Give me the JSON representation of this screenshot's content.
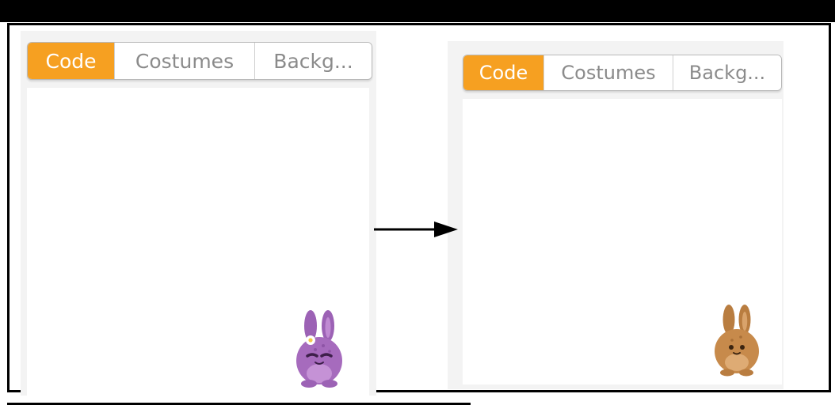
{
  "before": {
    "tabs": [
      {
        "label": "Code",
        "active": true
      },
      {
        "label": "Costumes",
        "active": false
      },
      {
        "label": "Backg...",
        "active": false
      }
    ],
    "sprite": {
      "icon": "purple-bunny-icon",
      "color": "#a66bbd"
    }
  },
  "after": {
    "tabs": [
      {
        "label": "Code",
        "active": true
      },
      {
        "label": "Costumes",
        "active": false
      },
      {
        "label": "Backg...",
        "active": false
      }
    ],
    "sprite": {
      "icon": "brown-bunny-icon",
      "color": "#c78a4b"
    }
  },
  "colors": {
    "accent": "#f6a021",
    "tab_text": "#8b8b8b",
    "panel_bg": "#f3f3f3"
  }
}
